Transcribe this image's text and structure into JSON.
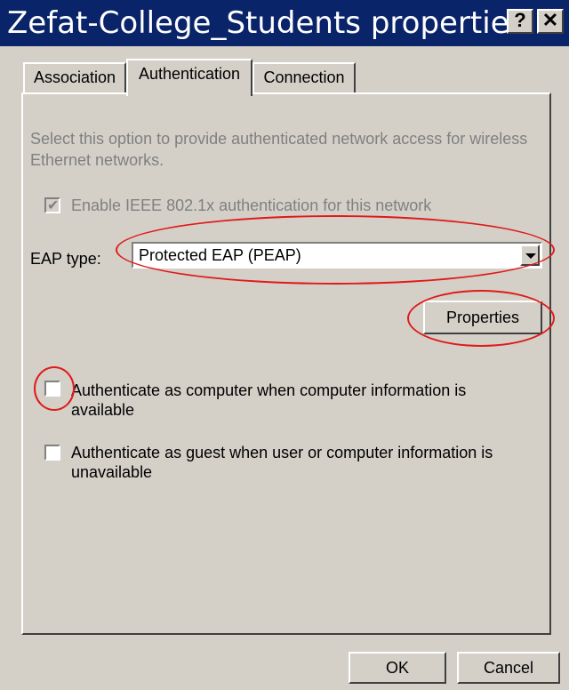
{
  "window": {
    "title": "Zefat-College_Students properties",
    "help_button": "?",
    "close_button": "✕"
  },
  "tabs": [
    {
      "label": "Association",
      "active": false
    },
    {
      "label": "Authentication",
      "active": true
    },
    {
      "label": "Connection",
      "active": false
    }
  ],
  "authentication": {
    "description": "Select this option to provide authenticated network access for wireless Ethernet networks.",
    "enable_8021x_label": "Enable IEEE 802.1x authentication for this network",
    "enable_8021x_checked": true,
    "eap_type_label": "EAP type:",
    "eap_type_value": "Protected EAP (PEAP)",
    "properties_button": "Properties",
    "auth_as_computer_label": "Authenticate as computer when computer information is available",
    "auth_as_computer_checked": false,
    "auth_as_guest_label": "Authenticate as guest when user or computer information is unavailable",
    "auth_as_guest_checked": false
  },
  "footer": {
    "ok_button": "OK",
    "cancel_button": "Cancel"
  },
  "colors": {
    "title_bar": "#0a246a",
    "dialog_face": "#d4d0c8",
    "annotation": "#e01a1a"
  }
}
